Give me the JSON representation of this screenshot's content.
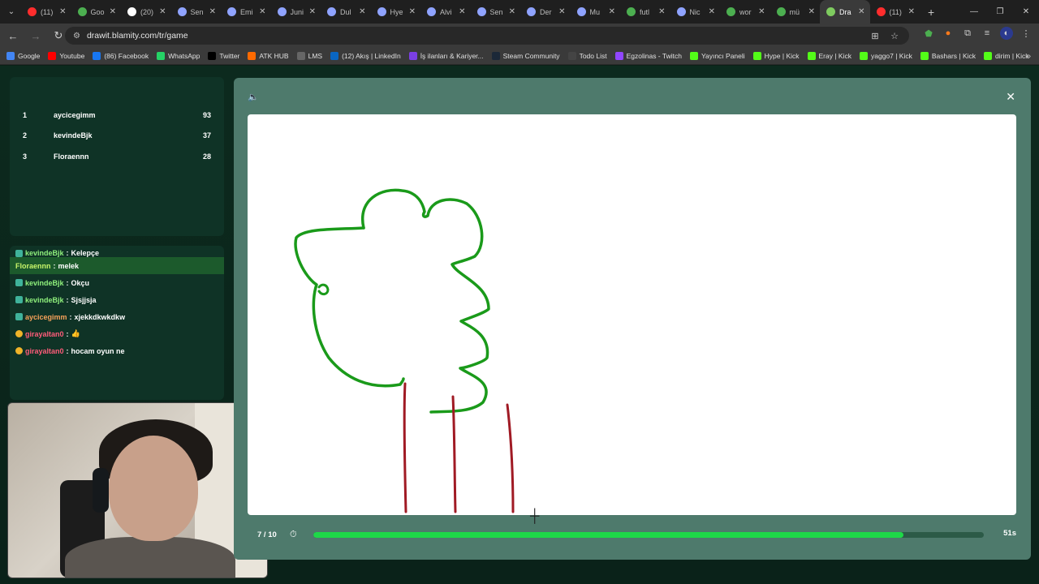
{
  "browser": {
    "tabs": [
      {
        "title": "(11)",
        "color": "#ff2d2d"
      },
      {
        "title": "Goo",
        "color": "#4caf50"
      },
      {
        "title": "(20)",
        "color": "#ffffff"
      },
      {
        "title": "Sen",
        "color": "#8fa3ff"
      },
      {
        "title": "Emi",
        "color": "#8fa3ff"
      },
      {
        "title": "Juni",
        "color": "#8fa3ff"
      },
      {
        "title": "Dul",
        "color": "#8fa3ff"
      },
      {
        "title": "Hye",
        "color": "#8fa3ff"
      },
      {
        "title": "Alvi",
        "color": "#8fa3ff"
      },
      {
        "title": "Sen",
        "color": "#8fa3ff"
      },
      {
        "title": "Der",
        "color": "#8fa3ff"
      },
      {
        "title": "Mu",
        "color": "#8fa3ff"
      },
      {
        "title": "futl",
        "color": "#4caf50"
      },
      {
        "title": "Nic",
        "color": "#8fa3ff"
      },
      {
        "title": "wor",
        "color": "#4caf50"
      },
      {
        "title": "mü",
        "color": "#4caf50"
      },
      {
        "title": "Dra",
        "color": "#7ecb5f"
      },
      {
        "title": "(11)",
        "color": "#ff2d2d"
      }
    ],
    "active_tab_index": 16,
    "url": "drawit.blamity.com/tr/game",
    "bookmarks": [
      {
        "label": "Google",
        "color": "#4285f4"
      },
      {
        "label": "Youtube",
        "color": "#ff0000"
      },
      {
        "label": "(86) Facebook",
        "color": "#1877f2"
      },
      {
        "label": "WhatsApp",
        "color": "#25d366"
      },
      {
        "label": "Twitter",
        "color": "#000000"
      },
      {
        "label": "ATK HUB",
        "color": "#ff6a00"
      },
      {
        "label": "LMS",
        "color": "#666666"
      },
      {
        "label": "(12) Akış | LinkedIn",
        "color": "#0a66c2"
      },
      {
        "label": "İş ilanları & Kariyer...",
        "color": "#7b3fe4"
      },
      {
        "label": "Steam Community",
        "color": "#1b2838"
      },
      {
        "label": "Todo List",
        "color": "#444444"
      },
      {
        "label": "Egzolinas - Twitch",
        "color": "#9146ff"
      },
      {
        "label": "Yayıncı Paneli",
        "color": "#53fc18"
      },
      {
        "label": "Hype | Kick",
        "color": "#53fc18"
      },
      {
        "label": "Eray | Kick",
        "color": "#53fc18"
      },
      {
        "label": "yaggo7 | Kick",
        "color": "#53fc18"
      },
      {
        "label": "Bashars | Kick",
        "color": "#53fc18"
      },
      {
        "label": "dirim | Kick",
        "color": "#53fc18"
      }
    ]
  },
  "scoreboard": [
    {
      "rank": "1",
      "name": "aycicegimm",
      "points": "93"
    },
    {
      "rank": "2",
      "name": "kevindeBjk",
      "points": "37"
    },
    {
      "rank": "3",
      "name": "Floraennn",
      "points": "28"
    }
  ],
  "chat": [
    {
      "user": "kevindeBjk",
      "sep": ":",
      "msg": "Kelepçe",
      "badge": "sq",
      "color": "u-green",
      "hl": false,
      "cut": true
    },
    {
      "user": "Floraennn",
      "sep": ":",
      "msg": "melek",
      "badge": "",
      "color": "u-lime",
      "hl": true,
      "cut": false
    },
    {
      "user": "kevindeBjk",
      "sep": ":",
      "msg": "Okçu",
      "badge": "sq",
      "color": "u-green",
      "hl": false,
      "cut": false
    },
    {
      "user": "kevindeBjk",
      "sep": ":",
      "msg": "Sjsjjsja",
      "badge": "sq",
      "color": "u-green",
      "hl": false,
      "cut": false
    },
    {
      "user": "aycicegimm",
      "sep": ":",
      "msg": "xjekkdkwkdkw",
      "badge": "sq",
      "color": "u-orange",
      "hl": false,
      "cut": false
    },
    {
      "user": "girayaltan0",
      "sep": ":",
      "msg": "👍",
      "badge": "round",
      "color": "u-pink",
      "hl": false,
      "cut": false
    },
    {
      "user": "girayaltan0",
      "sep": ":",
      "msg": "hocam oyun ne",
      "badge": "round",
      "color": "u-pink",
      "hl": false,
      "cut": false
    }
  ],
  "game": {
    "round": "7 / 10",
    "time_left": "51s",
    "progress_fraction": 0.88,
    "stroke_colors": {
      "tree": "#1a9a1a",
      "legs": "#a01a24"
    }
  }
}
